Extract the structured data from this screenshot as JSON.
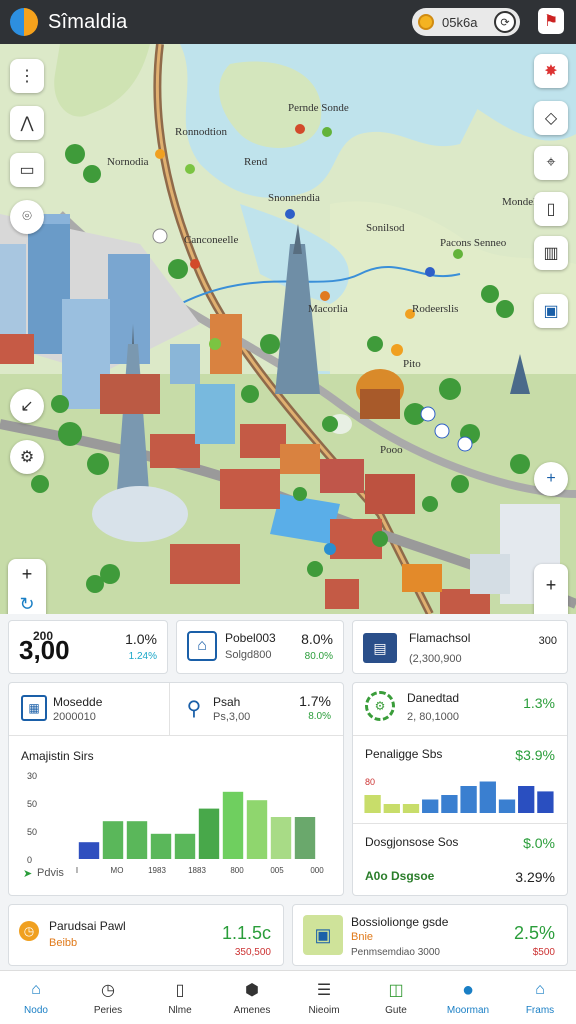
{
  "app": {
    "title": "Sîmaldia",
    "coins": "05k6a"
  },
  "map": {
    "labels": [
      "Pernde Sonde",
      "Ronnodtion",
      "Nornodia",
      "Rend",
      "Snonnendia",
      "Sonilsod",
      "Pacons Senneo",
      "Canconeelle",
      "Macorlia",
      "Rodeerslis",
      "Pito",
      "Pooo",
      "Mondel"
    ]
  },
  "cards": {
    "c1": {
      "value": "3,00",
      "prefix": "200",
      "pct": "1.0%",
      "sub": "1.24%"
    },
    "c2": {
      "title": "Pobel003",
      "sub": "Solgd800",
      "pct": "8.0%",
      "pct_sub": "80.0%"
    },
    "c3": {
      "title": "Flamachsol",
      "sub": "(2,300,900",
      "val": "300"
    },
    "c4": {
      "title": "Mosedde",
      "sub": "2000010"
    },
    "c5": {
      "title": "Psah",
      "sub": "Ps,3,00",
      "pct": "1.7%",
      "pct_sub": "8.0%"
    },
    "c6": {
      "title": "Danedtad",
      "sub": "2, 80,1000",
      "pct": "1.3%"
    },
    "c7": {
      "title": "Penaligge Sbs",
      "pct": "$3.9%"
    },
    "c8": {
      "title": "Dosgjonsose Sos",
      "pct": "$.0%"
    },
    "c9": {
      "title": "A0o Dsgsoe",
      "pct": "3.29%"
    },
    "c10": {
      "title": "Parudsai Pawl",
      "sub": "Beibb",
      "pct": "1.1.5c",
      "pct_sub": "350,500"
    },
    "c11": {
      "title": "Bossiolionge gsde",
      "sub": "Bnie",
      "sub2": "Penmsemdiao 3000",
      "pct": "2.5%",
      "pct_sub": "$500"
    }
  },
  "chart_data": [
    {
      "type": "bar",
      "title": "Amajistin Sirs",
      "categories": [
        "I",
        "MO",
        "1983",
        "1883",
        "800",
        "005",
        "000"
      ],
      "values": [
        2,
        4.5,
        4.5,
        3,
        3,
        6,
        8,
        7,
        5,
        5
      ],
      "ylim": [
        0,
        10
      ],
      "yticks": [
        "30",
        "50",
        "50",
        "0"
      ],
      "colors": [
        "#2f4fbf",
        "#5ab75a",
        "#5ab75a",
        "#5ab75a",
        "#5ab75a",
        "#48a84a",
        "#6fcf5f",
        "#8fd66e",
        "#a8db86",
        "#6aa86c"
      ],
      "legend": "Pdvis"
    },
    {
      "type": "bar",
      "title": "Penaligge Sbs",
      "values": [
        2,
        1,
        1,
        1.5,
        2,
        3,
        3.5,
        1.5,
        3,
        2.4
      ],
      "ylim": [
        0,
        4
      ],
      "colors": [
        "#c8dd6a",
        "#c8dd6a",
        "#c8dd6a",
        "#3a7fd0",
        "#3a7fd0",
        "#3a7fd0",
        "#3a7fd0",
        "#3a7fd0",
        "#2a4fc0",
        "#2a4fc0"
      ],
      "note": "80"
    }
  ],
  "nav": {
    "items": [
      "Nodo",
      "Peries",
      "Nlme",
      "Amenes",
      "Nieoim",
      "Gute",
      "Moorman",
      "Frams"
    ]
  }
}
